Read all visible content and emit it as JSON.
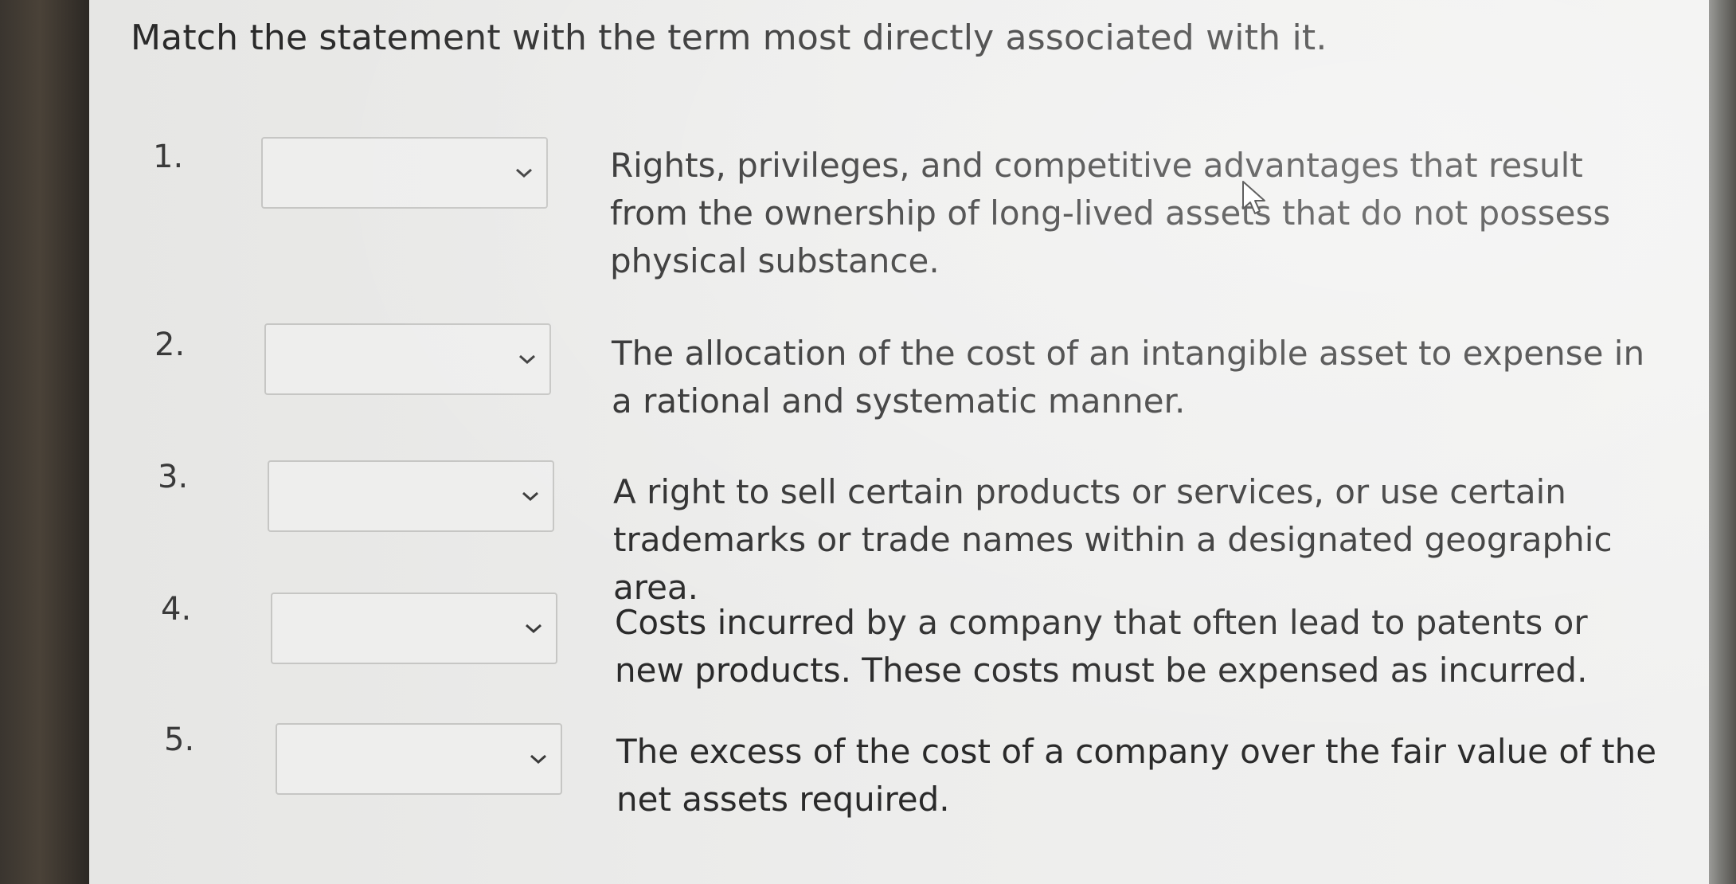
{
  "instruction": "Match the statement with the term most directly associated with it.",
  "questions": [
    {
      "number": "1.",
      "selected": "",
      "statement": "Rights, privileges, and competitive advantages that result from the ownership of long-lived assets that do not possess physical substance."
    },
    {
      "number": "2.",
      "selected": "",
      "statement": "The allocation of the cost of an intangible asset to expense in a rational and systematic manner."
    },
    {
      "number": "3.",
      "selected": "",
      "statement": "A right to sell certain products or services, or use certain trademarks or trade names within a designated geographic area."
    },
    {
      "number": "4.",
      "selected": "",
      "statement": "Costs incurred by a company that often lead to patents or new products. These costs must be expensed as incurred."
    },
    {
      "number": "5.",
      "selected": "",
      "statement": "The excess of the cost of a company over the fair value of the net assets required."
    }
  ],
  "icons": {
    "dropdown": "chevron-down-icon",
    "cursor": "mouse-pointer-icon"
  },
  "colors": {
    "text": "#2a2a2a",
    "dropdown_border": "#c6c6c4",
    "background": "#ededec"
  }
}
